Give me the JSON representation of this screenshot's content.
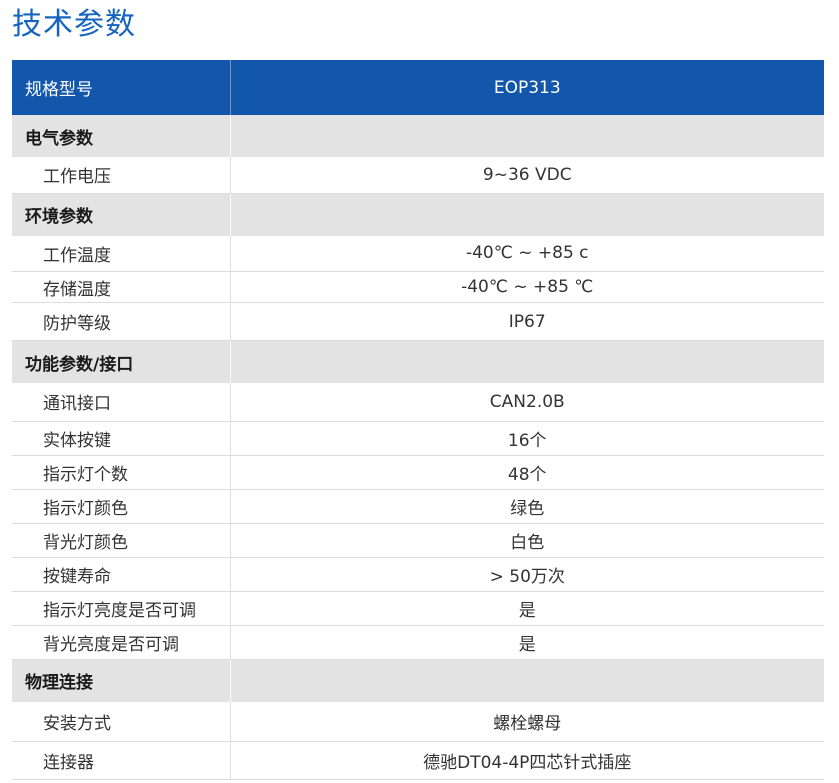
{
  "title": "技术参数",
  "table": {
    "header": {
      "label": "规格型号",
      "value": "EOP313"
    },
    "sections": [
      {
        "name": "电气参数",
        "rows": [
          {
            "label": "工作电压",
            "value": "9~36 VDC"
          }
        ]
      },
      {
        "name": "环境参数",
        "rows": [
          {
            "label": "工作温度",
            "value": "-40℃ ~  +85 c"
          },
          {
            "label": "存储温度",
            "value": "-40℃ ~  +85 ℃"
          },
          {
            "label": "防护等级",
            "value": "IP67"
          }
        ]
      },
      {
        "name": "功能参数/接口",
        "rows": [
          {
            "label": "通讯接口",
            "value": "CAN2.0B"
          },
          {
            "label": "实体按键",
            "value": "16个"
          },
          {
            "label": "指示灯个数",
            "value": "48个"
          },
          {
            "label": "指示灯颜色",
            "value": "绿色"
          },
          {
            "label": "背光灯颜色",
            "value": "白色"
          },
          {
            "label": "按键寿命",
            "value": "> 50万次"
          },
          {
            "label": "指示灯亮度是否可调",
            "value": "是"
          },
          {
            "label": "背光亮度是否可调",
            "value": "是"
          }
        ]
      },
      {
        "name": "物理连接",
        "rows": [
          {
            "label": "安装方式",
            "value": "螺栓螺母"
          },
          {
            "label": "连接器",
            "value": "德驰DT04-4P四芯针式插座"
          }
        ]
      }
    ]
  },
  "colors": {
    "title": "#1565c0",
    "header_bg": "#1257ab",
    "section_bg": "#e3e3e3",
    "row_border": "#dcdcdc"
  }
}
